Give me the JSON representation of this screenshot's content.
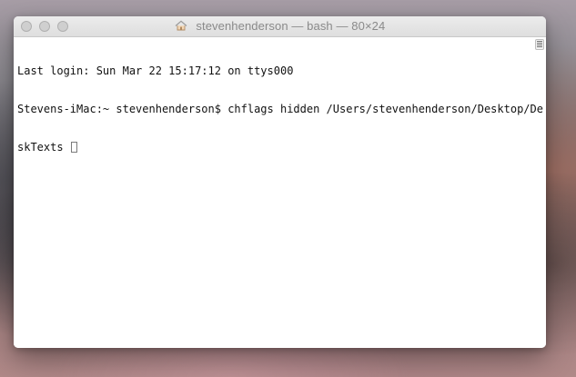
{
  "window": {
    "title": "stevenhenderson — bash — 80×24",
    "title_icon": "home-icon"
  },
  "terminal": {
    "lines": [
      "Last login: Sun Mar 22 15:17:12 on ttys000",
      "Stevens-iMac:~ stevenhenderson$ chflags hidden /Users/stevenhenderson/Desktop/De",
      "skTexts"
    ]
  },
  "icons": {
    "close": "close-icon",
    "minimize": "minimize-icon",
    "zoom": "zoom-icon",
    "scrollbar_toggle": "scrollbar-toggle-icon"
  },
  "colors": {
    "window_background": "#ffffff",
    "titlebar_top": "#ececec",
    "titlebar_bottom": "#dedede",
    "title_text": "#8a8a8a",
    "terminal_text": "#111111",
    "traffic_lights": "#cfcfcf"
  }
}
